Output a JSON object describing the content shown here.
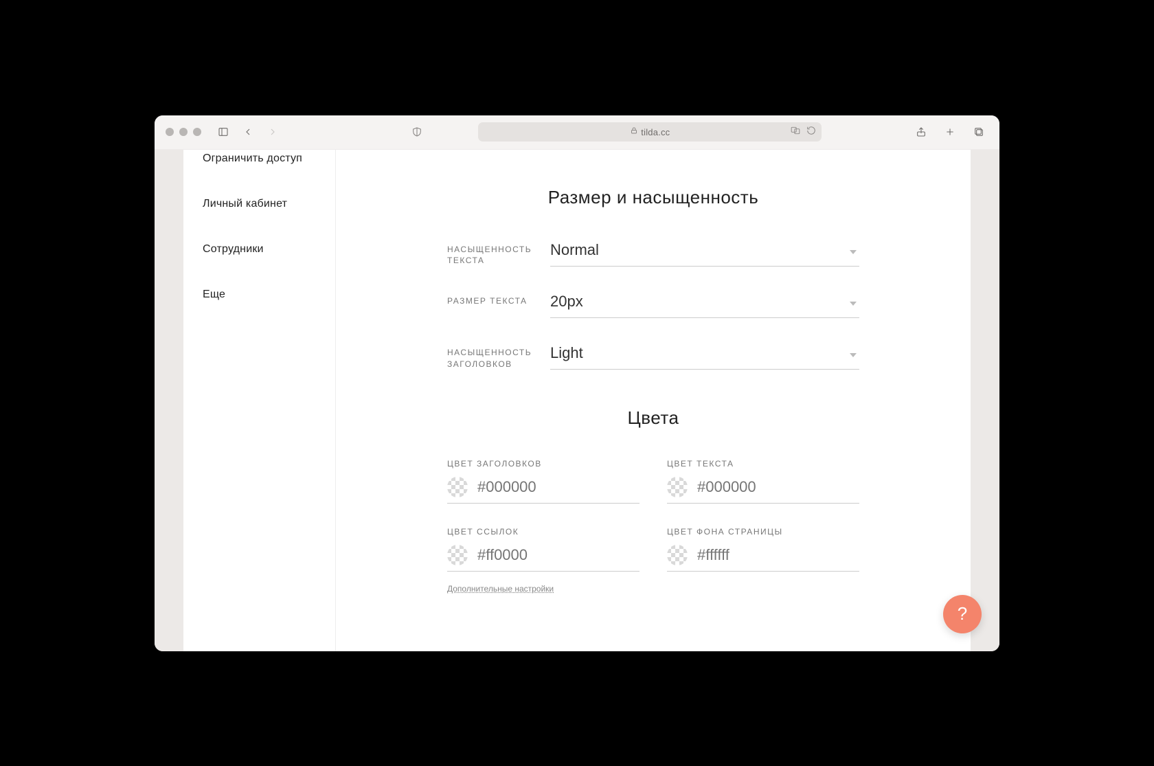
{
  "browser": {
    "domain": "tilda.cc"
  },
  "sidebar": {
    "items": [
      {
        "label": "Ограничить доступ"
      },
      {
        "label": "Личный кабинет"
      },
      {
        "label": "Сотрудники"
      },
      {
        "label": "Еще"
      }
    ]
  },
  "sections": {
    "size": {
      "title": "Размер и насыщенность",
      "fields": {
        "text_weight": {
          "label": "НАСЫЩЕННОСТЬ ТЕКСТА",
          "value": "Normal"
        },
        "text_size": {
          "label": "РАЗМЕР ТЕКСТА",
          "value": "20px"
        },
        "head_weight": {
          "label": "НАСЫЩЕННОСТЬ ЗАГОЛОВКОВ",
          "value": "Light"
        }
      }
    },
    "colors": {
      "title": "Цвета",
      "fields": {
        "head_color": {
          "label": "ЦВЕТ ЗАГОЛОВКОВ",
          "placeholder": "#000000"
        },
        "text_color": {
          "label": "ЦВЕТ ТЕКСТА",
          "placeholder": "#000000"
        },
        "link_color": {
          "label": "ЦВЕТ ССЫЛОК",
          "placeholder": "#ff0000"
        },
        "bg_color": {
          "label": "ЦВЕТ ФОНА СТРАНИЦЫ",
          "placeholder": "#ffffff"
        }
      },
      "more_link": "Дополнительные настройки"
    }
  },
  "help": {
    "label": "?"
  }
}
